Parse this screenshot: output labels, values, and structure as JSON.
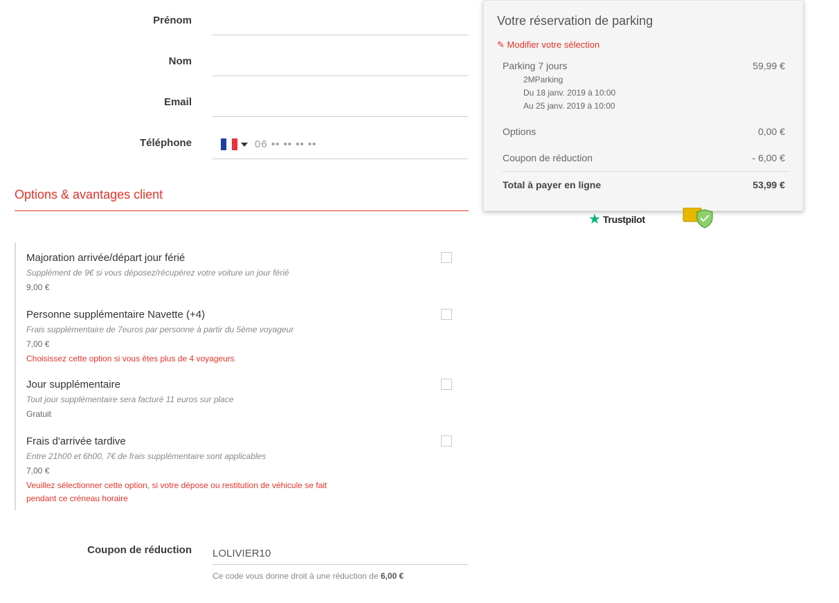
{
  "form": {
    "prenom_label": "Prénom",
    "nom_label": "Nom",
    "email_label": "Email",
    "telephone_label": "Téléphone",
    "prenom_value": "",
    "nom_value": "",
    "email_value": "",
    "phone_placeholder": "06 •• •• •• ••",
    "phone_country_flag": "fr-flag-icon"
  },
  "options_section": {
    "title": "Options & avantages client",
    "items": [
      {
        "title": "Majoration arrivée/départ jour férié",
        "description": "Supplément de 9€ si vous déposez/récupérez votre voiture un jour férié",
        "price": "9,00 €",
        "note": ""
      },
      {
        "title": "Personne supplémentaire Navette (+4)",
        "description": "Frais supplémentaire de 7euros par personne à partir du 5ème voyageur",
        "price": "7,00 €",
        "note": "Choisissez cette option si vous êtes plus de 4 voyageurs"
      },
      {
        "title": "Jour supplémentaire",
        "description": "Tout jour supplémentaire sera facturé 11 euros sur place",
        "price": "Gratuit",
        "note": ""
      },
      {
        "title": "Frais d'arrivée tardive",
        "description": "Entre 21h00 et 6h00, 7€ de frais supplémentaire sont applicables",
        "price": "7,00 €",
        "note": "Veuillez sélectionner cette option, si votre dépose ou restitution de véhicule se fait pendant ce créneau horaire"
      }
    ]
  },
  "coupon": {
    "label": "Coupon de réduction",
    "value": "LOLIVIER10",
    "note_prefix": "Ce code vous donne droit à une réduction de",
    "note_amount": "6,00 €"
  },
  "summary": {
    "title": "Votre réservation de parking",
    "modify_link": "Modifier votre sélection",
    "parking_label": "Parking 7 jours",
    "parking_amount": "59,99 €",
    "provider": "2MParking",
    "from": "Du 18 janv. 2019 à 10:00",
    "to": "Au 25 janv. 2019 à 10:00",
    "options_label": "Options",
    "options_amount": "0,00 €",
    "coupon_label": "Coupon de réduction",
    "coupon_amount": "- 6,00 €",
    "total_label": "Total à payer en ligne",
    "total_amount": "53,99 €"
  },
  "trust": {
    "trustpilot_label": "Trustpilot",
    "star_icon": "star-icon",
    "badge_icon": "shield-check-icon"
  },
  "colors": {
    "accent": "#e2342a",
    "trustpilot_green": "#00b67a"
  }
}
